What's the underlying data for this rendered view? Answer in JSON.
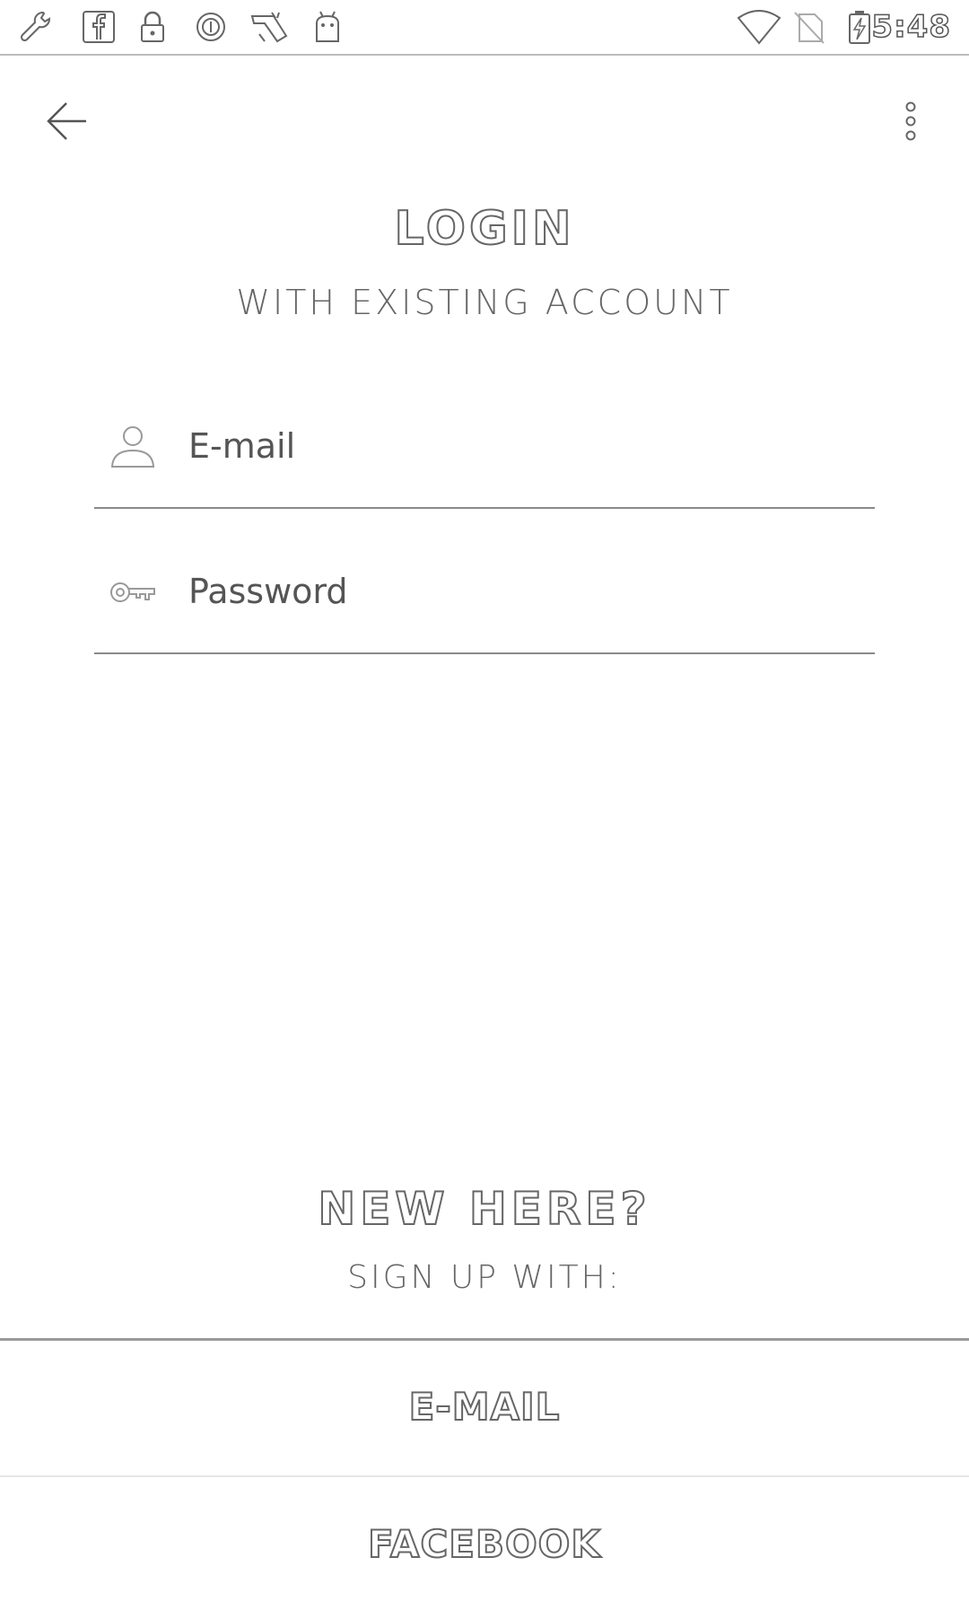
{
  "status_bar": {
    "time": "5:48",
    "left_icons": [
      "wrench-icon",
      "facebook-icon",
      "lock-icon",
      "circle-icon",
      "app-icon",
      "android-icon"
    ],
    "right_icons": [
      "wifi-icon",
      "no-sim-icon",
      "battery-charging-icon"
    ]
  },
  "toolbar": {
    "back_icon": "arrow-left-icon",
    "overflow_icon": "more-vert-icon"
  },
  "login": {
    "title": "LOGIN",
    "subtitle": "WITH EXISTING ACCOUNT",
    "email_placeholder": "E-mail",
    "password_placeholder": "Password"
  },
  "signup": {
    "title": "NEW HERE?",
    "subtitle": "SIGN UP WITH:",
    "email_button": "E-MAIL",
    "facebook_button": "FACEBOOK"
  }
}
